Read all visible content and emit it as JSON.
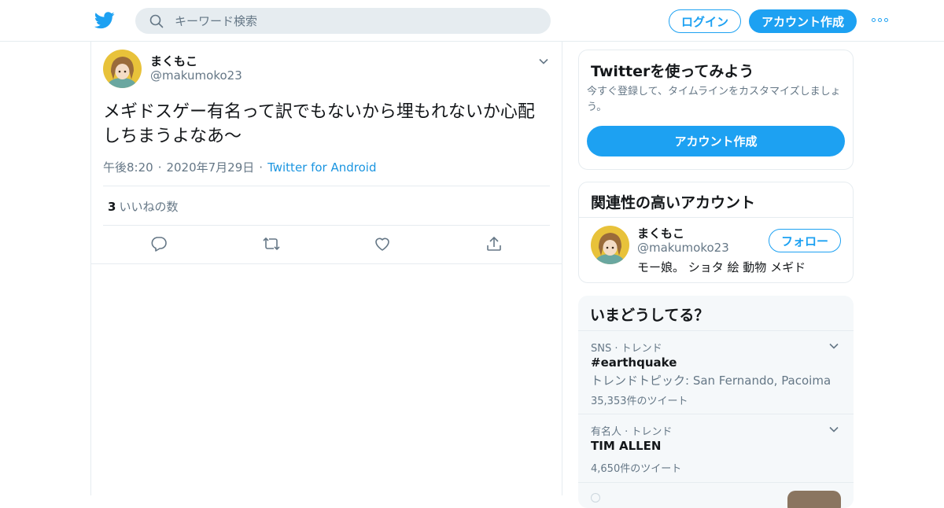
{
  "colors": {
    "brand": "#1da1f2",
    "link": "#1b95e0",
    "muted": "#657786",
    "text": "#14171a",
    "border": "#e6ecf0"
  },
  "header": {
    "logo_icon": "twitter-bird-icon",
    "search_placeholder": "キーワード検索",
    "login_label": "ログイン",
    "signup_label": "アカウント作成",
    "more_icon": "more-dots-icon"
  },
  "tweet": {
    "author_name": "まくもこ",
    "author_handle": "@makumoko23",
    "text": "メギドスゲー有名って訳でもないから埋もれないか心配しちまうよなあ～",
    "time": "午後8:20",
    "date": "2020年7月29日",
    "source": "Twitter for Android",
    "like_count": "3",
    "like_label": "いいねの数",
    "actions": [
      "reply-icon",
      "retweet-icon",
      "like-icon",
      "share-icon"
    ]
  },
  "signup_card": {
    "title": "Twitterを使ってみよう",
    "description": "今すぐ登録して、タイムラインをカスタマイズしましょう。",
    "button_label": "アカウント作成"
  },
  "related_card": {
    "title": "関連性の高いアカウント",
    "account": {
      "name": "まくもこ",
      "handle": "@makumoko23",
      "bio": "モー娘。 ショタ 絵 動物 メギド",
      "follow_label": "フォロー"
    }
  },
  "trends_card": {
    "title": "いまどうしてる？",
    "items": [
      {
        "context": "SNS · トレンド",
        "name": "#earthquake",
        "subtitle": "トレンドトピック: San Fernando, Pacoima",
        "count": "35,353件のツイート"
      },
      {
        "context": "有名人 · トレンド",
        "name": "TIM ALLEN",
        "count": "4,650件のツイート"
      }
    ]
  }
}
